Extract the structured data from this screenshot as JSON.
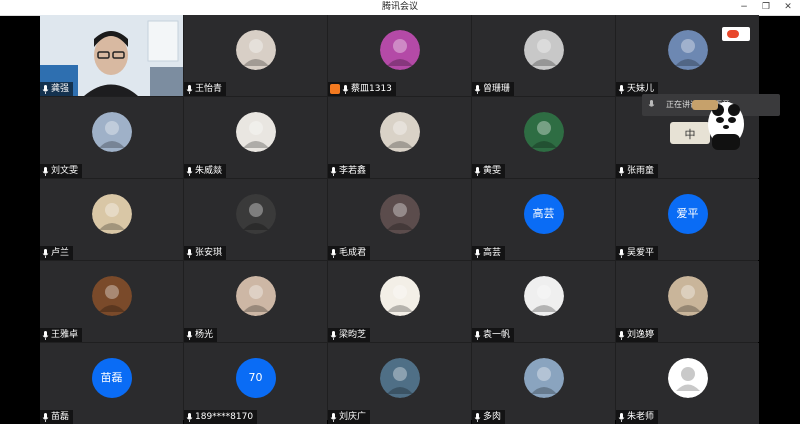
{
  "window": {
    "title": "腾讯会议",
    "minimize": "−",
    "restore": "❐",
    "close": "✕"
  },
  "popup": {
    "text": "正在讲话：张雨童"
  },
  "tiles": [
    {
      "name": "龚强",
      "avatar_type": "video",
      "speaking": true
    },
    {
      "name": "王怡青",
      "avatar_type": "photo",
      "color": "#d8cfc6"
    },
    {
      "name": "蔡皿1313",
      "avatar_type": "photo",
      "color": "#b44aa7",
      "share": true
    },
    {
      "name": "曾珊珊",
      "avatar_type": "photo",
      "color": "#c8c8c8"
    },
    {
      "name": "天妹儿",
      "avatar_type": "photo",
      "color": "#6d88b2"
    },
    {
      "name": "刘文雯",
      "avatar_type": "photo",
      "color": "#9fb1c8"
    },
    {
      "name": "朱威燚",
      "avatar_type": "photo",
      "color": "#e9e6e1"
    },
    {
      "name": "李若鑫",
      "avatar_type": "photo",
      "color": "#d9d2c7"
    },
    {
      "name": "黄雯",
      "avatar_type": "photo",
      "color": "#2e6d43"
    },
    {
      "name": "张雨童",
      "avatar_type": "sticker"
    },
    {
      "name": "卢兰",
      "avatar_type": "photo",
      "color": "#d9c7a6"
    },
    {
      "name": "张安琪",
      "avatar_type": "photo",
      "color": "#3a3a3a"
    },
    {
      "name": "毛成君",
      "avatar_type": "photo",
      "color": "#5b4c4c"
    },
    {
      "name": "高芸",
      "avatar_type": "text",
      "avatar_text": "高芸"
    },
    {
      "name": "吴爱平",
      "avatar_type": "text",
      "avatar_text": "爱平"
    },
    {
      "name": "王雅卓",
      "avatar_type": "photo",
      "color": "#7a4a2a"
    },
    {
      "name": "杨光",
      "avatar_type": "photo",
      "color": "#cdb7a5"
    },
    {
      "name": "梁昀芝",
      "avatar_type": "photo",
      "color": "#f3efe7"
    },
    {
      "name": "袁一帆",
      "avatar_type": "photo",
      "color": "#efefef"
    },
    {
      "name": "刘逸婷",
      "avatar_type": "photo",
      "color": "#c9b59a"
    },
    {
      "name": "苗磊",
      "avatar_type": "text",
      "avatar_text": "苗磊"
    },
    {
      "name": "189****8170",
      "avatar_type": "text",
      "avatar_text": "70"
    },
    {
      "name": "刘庆广",
      "avatar_type": "photo",
      "color": "#4f6f86"
    },
    {
      "name": "多肉",
      "avatar_type": "photo",
      "color": "#8aa4bf"
    },
    {
      "name": "朱老师",
      "avatar_type": "default"
    }
  ],
  "colors": {
    "text_avatar": "#0a6cf5",
    "speaking_border": "#1fd0a0",
    "tile_bg": "#2b2b2d"
  }
}
